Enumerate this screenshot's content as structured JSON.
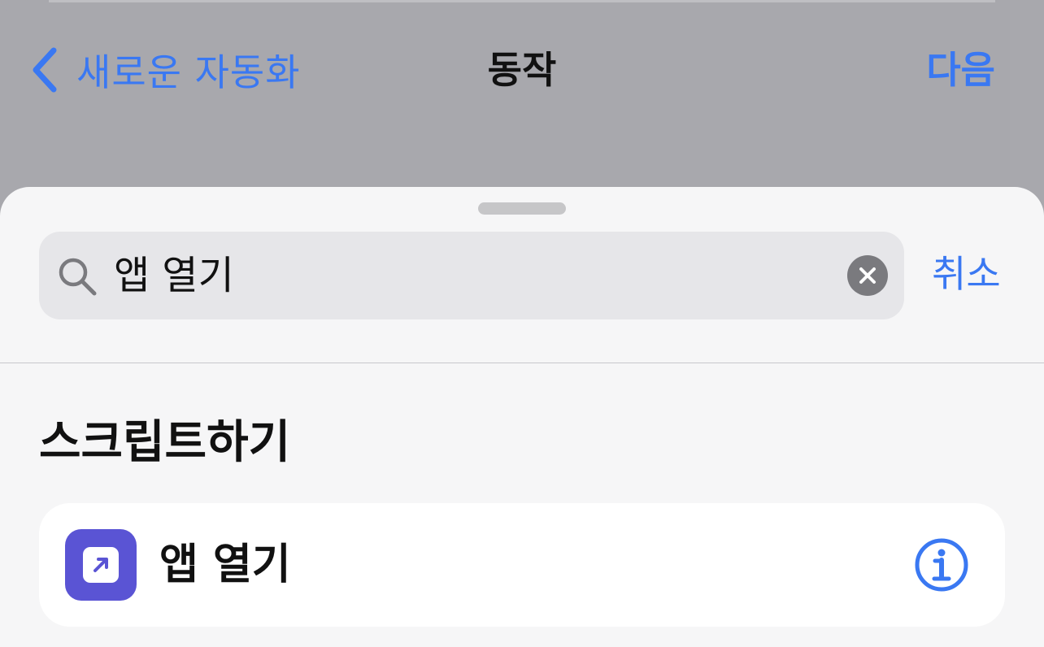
{
  "nav": {
    "back_label": "새로운 자동화",
    "title": "동작",
    "next_label": "다음"
  },
  "search": {
    "value": "앱 열기",
    "cancel_label": "취소"
  },
  "section": {
    "header": "스크립트하기"
  },
  "actions": [
    {
      "label": "앱 열기",
      "icon": "open-app-icon"
    }
  ],
  "colors": {
    "accent": "#3a78f2",
    "app_icon_bg": "#5a54d4",
    "dim_background": "#a8a8ad",
    "sheet_background": "#f6f6f7"
  }
}
